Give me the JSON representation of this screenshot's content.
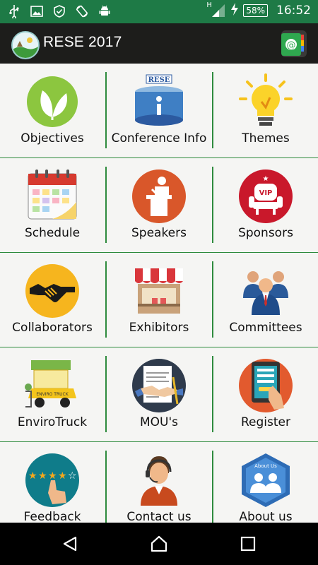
{
  "statusbar": {
    "network_type": "H",
    "battery_percent": "58%",
    "time": "16:52",
    "icons": [
      "usb-icon",
      "gallery-icon",
      "shield-icon",
      "screen-rotate-icon",
      "android-icon",
      "signal-icon",
      "charging-icon"
    ]
  },
  "appbar": {
    "title": "RESE 2017",
    "logo": "rese-logo-icon",
    "contact_icon": "contacts-at-icon"
  },
  "menu": {
    "rows": [
      [
        {
          "label": "Objectives",
          "icon": "leaf-icon"
        },
        {
          "label": "Conference Info",
          "icon": "info-podium-icon"
        },
        {
          "label": "Themes",
          "icon": "lightbulb-icon"
        }
      ],
      [
        {
          "label": "Schedule",
          "icon": "calendar-icon"
        },
        {
          "label": "Speakers",
          "icon": "speaker-podium-icon"
        },
        {
          "label": "Sponsors",
          "icon": "vip-seat-icon"
        }
      ],
      [
        {
          "label": "Collaborators",
          "icon": "handshake-icon"
        },
        {
          "label": "Exhibitors",
          "icon": "stall-icon"
        },
        {
          "label": "Committees",
          "icon": "committee-people-icon"
        }
      ],
      [
        {
          "label": "EnviroTruck",
          "icon": "truck-icon"
        },
        {
          "label": "MOU's",
          "icon": "agreement-icon"
        },
        {
          "label": "Register",
          "icon": "tablet-register-icon"
        }
      ],
      [
        {
          "label": "Feedback",
          "icon": "rating-stars-icon"
        },
        {
          "label": "Contact us",
          "icon": "support-agent-icon"
        },
        {
          "label": "About us",
          "icon": "about-us-icon"
        }
      ]
    ],
    "truck_sign": "ENVIRO TRUCK",
    "vip_text": "VIP",
    "rese_sign": "RESE",
    "about_text": "About Us"
  },
  "navbar": {
    "icons": [
      "back-icon",
      "home-icon",
      "recents-icon"
    ]
  },
  "colors": {
    "status_bar": "#1e7a46",
    "app_bar": "#1d1d1b",
    "divider": "#2e8b3d",
    "background": "#f5f5f3"
  }
}
